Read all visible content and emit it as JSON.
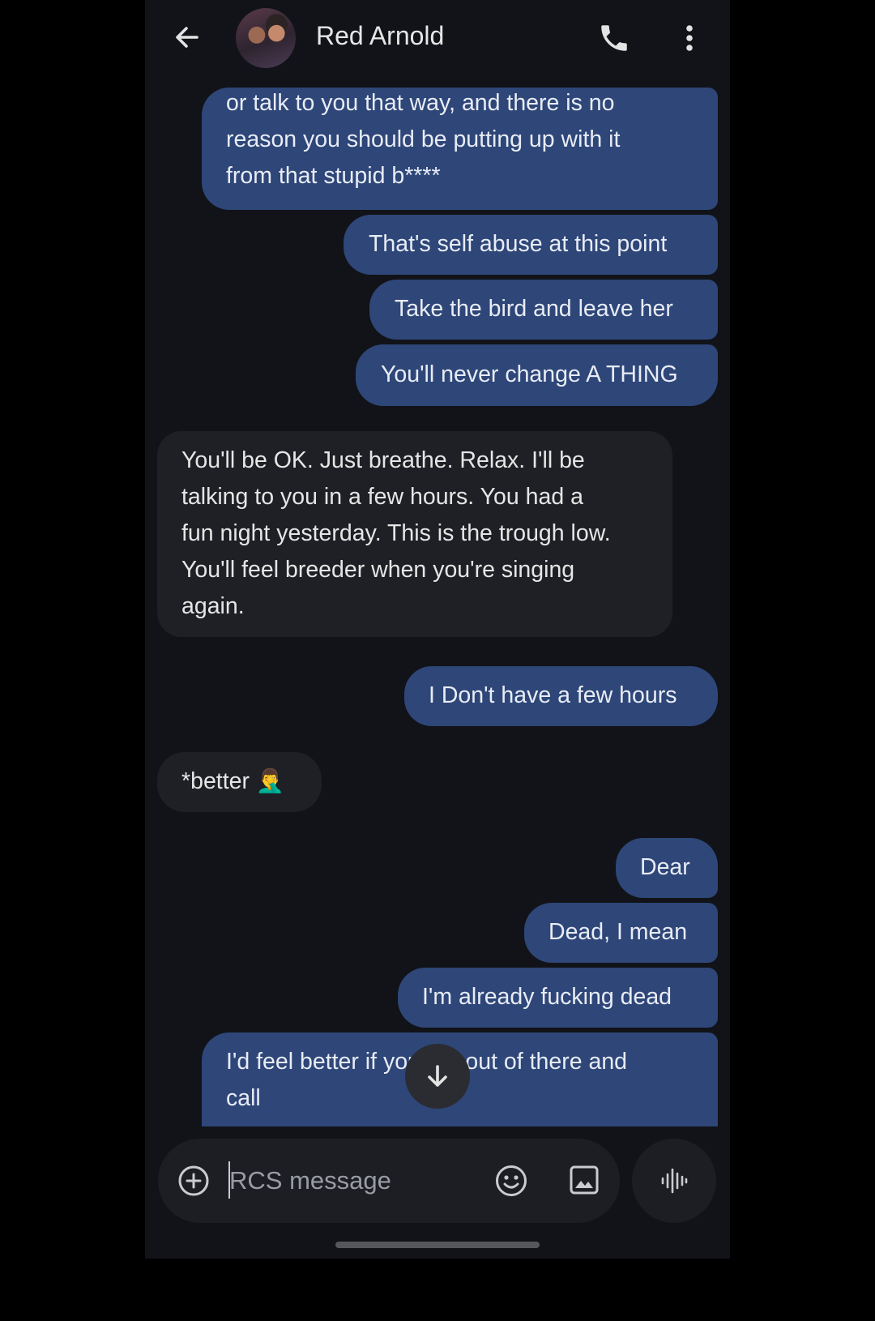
{
  "contact": {
    "name": "Red Arnold"
  },
  "messages": [
    {
      "direction": "sent",
      "lines": [
        "or talk to you that way, and there is no",
        "reason you should be putting up with it",
        "from that stupid b****"
      ]
    },
    {
      "direction": "sent",
      "lines": [
        "That's self abuse at this point"
      ]
    },
    {
      "direction": "sent",
      "lines": [
        "Take the bird and leave her"
      ]
    },
    {
      "direction": "sent",
      "lines": [
        "You'll never change A THING"
      ]
    },
    {
      "direction": "received",
      "lines": [
        "You'll be OK. Just breathe. Relax. I'll be",
        "talking to you in a few hours. You had a",
        "fun night yesterday. This is the trough low.",
        "You'll feel breeder when you're singing",
        "again."
      ]
    },
    {
      "direction": "sent",
      "lines": [
        "I Don't have a few hours"
      ]
    },
    {
      "direction": "received",
      "lines": [
        "*better 🤦‍♂️"
      ]
    },
    {
      "direction": "sent",
      "lines": [
        "Dear"
      ]
    },
    {
      "direction": "sent",
      "lines": [
        "Dead, I mean"
      ]
    },
    {
      "direction": "sent",
      "lines": [
        "I'm already fucking dead"
      ]
    },
    {
      "direction": "sent",
      "lines": [
        "I'd feel better if you get out of there and",
        "call"
      ]
    }
  ],
  "compose": {
    "placeholder": "RCS message"
  },
  "icons": {
    "back": "arrow-left-icon",
    "call": "phone-icon",
    "menu": "more-vertical-icon",
    "scroll_down": "arrow-down-icon",
    "add": "plus-circle-icon",
    "emoji": "emoji-icon",
    "image": "image-icon",
    "voice": "voice-waveform-icon"
  },
  "colors": {
    "background": "#111318",
    "sent_bubble": "#2e4678",
    "received_bubble": "#1e2025"
  }
}
